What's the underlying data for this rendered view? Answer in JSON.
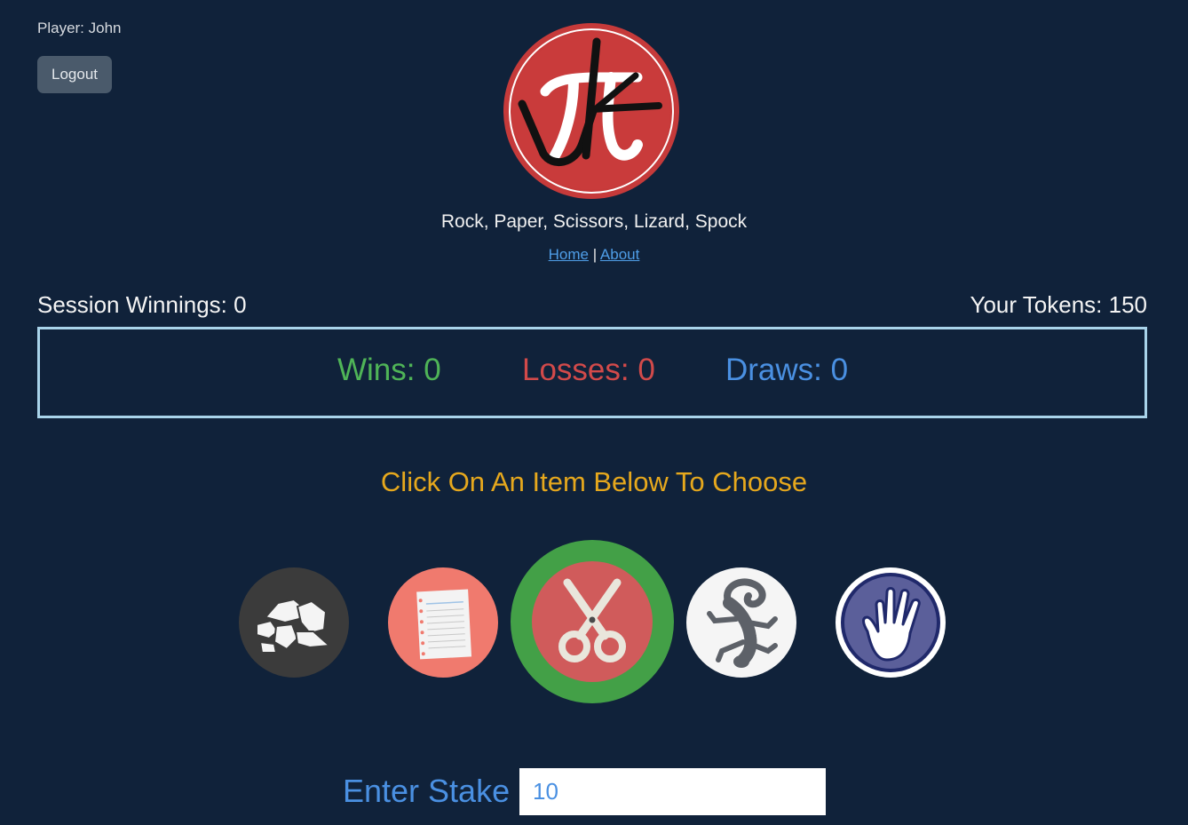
{
  "player": {
    "label": "Player: John"
  },
  "header": {
    "logout_label": "Logout",
    "subtitle": "Rock, Paper, Scissors, Lizard, Spock",
    "nav": {
      "home": "Home",
      "separator": " | ",
      "about": "About"
    }
  },
  "stats": {
    "session_winnings": "Session Winnings: 0",
    "tokens": "Your Tokens: 150",
    "wins": "Wins: 0",
    "losses": "Losses: 0",
    "draws": "Draws: 0"
  },
  "instruction": "Click On An Item Below To Choose",
  "choices": [
    {
      "name": "rock",
      "icon": "rock-icon",
      "selected": false
    },
    {
      "name": "paper",
      "icon": "paper-icon",
      "selected": false
    },
    {
      "name": "scissors",
      "icon": "scissors-icon",
      "selected": true
    },
    {
      "name": "lizard",
      "icon": "lizard-icon",
      "selected": false
    },
    {
      "name": "spock",
      "icon": "spock-icon",
      "selected": false
    }
  ],
  "stake": {
    "label": "Enter Stake",
    "value": "10"
  },
  "colors": {
    "background": "#10223a",
    "wins": "#4fb457",
    "losses": "#d24a4a",
    "draws": "#4a90e2",
    "instruction": "#e6a81d",
    "selected_ring": "#43a047"
  }
}
